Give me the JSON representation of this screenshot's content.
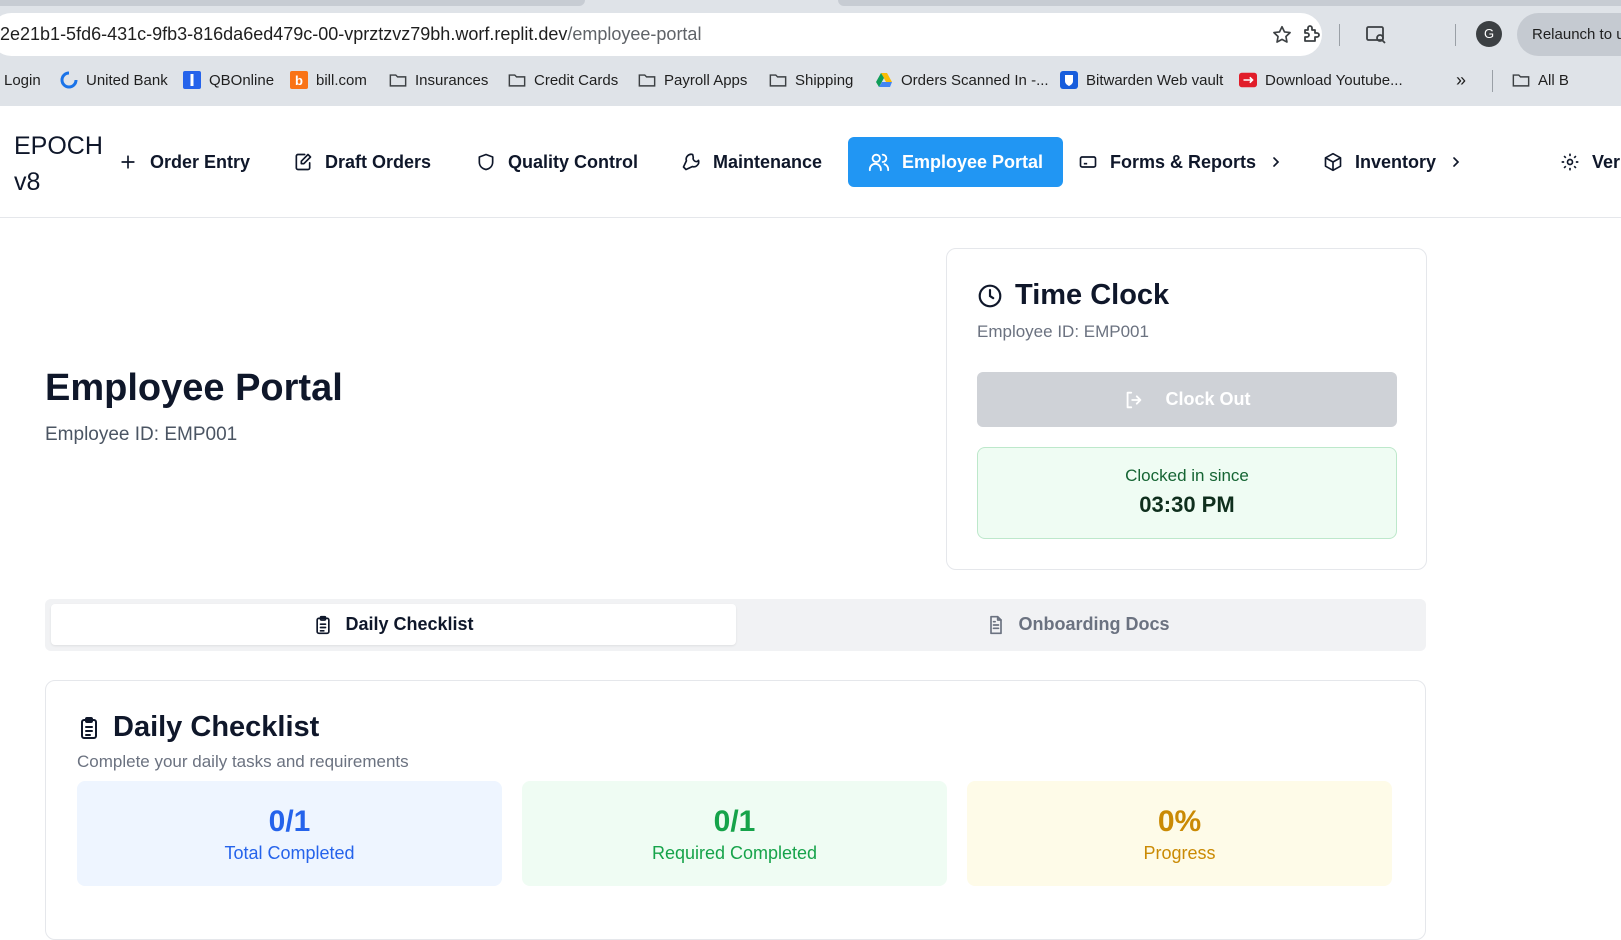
{
  "browser": {
    "url_host": "2e21b1-5fd6-431c-9fb3-816da6ed479c-00-vprztzvz79bh.worf.replit.dev",
    "url_path": "/employee-portal",
    "relaunch_label": "Relaunch to u",
    "profile_initial": "G",
    "bookmarks": [
      {
        "label": "Login",
        "icon": "none"
      },
      {
        "label": "United Bank",
        "icon": "united-bank-icon"
      },
      {
        "label": "QBOnline",
        "icon": "qbonline-icon"
      },
      {
        "label": "bill.com",
        "icon": "bill-icon"
      },
      {
        "label": "Insurances",
        "icon": "folder-icon"
      },
      {
        "label": "Credit Cards",
        "icon": "folder-icon"
      },
      {
        "label": "Payroll Apps",
        "icon": "folder-icon"
      },
      {
        "label": "Shipping",
        "icon": "folder-icon"
      },
      {
        "label": "Orders Scanned In -...",
        "icon": "google-drive-icon"
      },
      {
        "label": "Bitwarden Web vault",
        "icon": "bitwarden-icon"
      },
      {
        "label": "Download Youtube...",
        "icon": "youtube-download-icon"
      }
    ],
    "bookmarks_overflow": "»",
    "all_bookmarks_label": "All B"
  },
  "app": {
    "brand_line1": "EPOCH",
    "brand_line2": "v8",
    "nav": [
      {
        "label": "Order Entry",
        "icon": "plus-icon",
        "active": false
      },
      {
        "label": "Draft Orders",
        "icon": "edit-icon",
        "active": false
      },
      {
        "label": "Quality Control",
        "icon": "shield-icon",
        "active": false
      },
      {
        "label": "Maintenance",
        "icon": "wrench-icon",
        "active": false
      },
      {
        "label": "Employee Portal",
        "icon": "users-icon",
        "active": true
      },
      {
        "label": "Forms & Reports",
        "icon": "card-icon",
        "active": false,
        "submenu": true
      },
      {
        "label": "Inventory",
        "icon": "package-icon",
        "active": false,
        "submenu": true
      },
      {
        "label": "Ver",
        "icon": "gear-icon",
        "active": false
      }
    ],
    "accent_color": "#2196f3"
  },
  "page": {
    "title": "Employee Portal",
    "employee_id_label": "Employee ID: EMP001"
  },
  "time_clock": {
    "title": "Time Clock",
    "employee_id_label": "Employee ID: EMP001",
    "clock_out_label": "Clock Out",
    "status_label": "Clocked in since",
    "status_time": "03:30 PM"
  },
  "tabs": {
    "daily_checklist": "Daily Checklist",
    "onboarding_docs": "Onboarding Docs",
    "active": "daily_checklist"
  },
  "checklist": {
    "title": "Daily Checklist",
    "subtitle": "Complete your daily tasks and requirements",
    "stats": {
      "total": {
        "value": "0/1",
        "label": "Total Completed",
        "color": "#2563eb"
      },
      "required": {
        "value": "0/1",
        "label": "Required Completed",
        "color": "#16a34a"
      },
      "progress": {
        "value": "0%",
        "label": "Progress",
        "color": "#ca8a04"
      }
    }
  }
}
